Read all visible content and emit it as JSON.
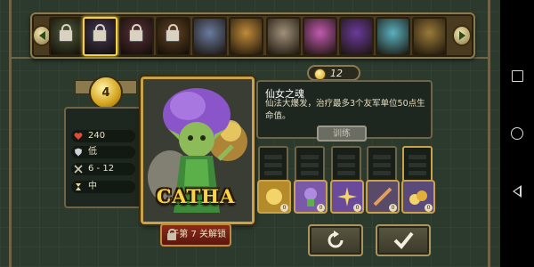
{
  "hero": {
    "name": "CATHA",
    "level": "4"
  },
  "stats": [
    {
      "icon": "heart-icon",
      "value": "240",
      "color": "#e04a3a"
    },
    {
      "icon": "shield-icon",
      "value": "低",
      "color": "#cfd4d6"
    },
    {
      "icon": "swords-icon",
      "value": "6 - 12",
      "color": "#cfcab6"
    },
    {
      "icon": "hourglass-icon",
      "value": "中",
      "color": "#e6d7a5"
    }
  ],
  "coins": {
    "value": "12"
  },
  "skill": {
    "title": "仙女之魂",
    "description": "仙法大爆发，治疗最多3个友军单位50点生命值。"
  },
  "train_button": "训练",
  "unlock_button": "于第 7 关解锁",
  "skill_levels": [
    "0",
    "0",
    "0",
    "0",
    "0"
  ],
  "portraits": [
    {
      "name": "hero-1",
      "locked": true,
      "color": "#7a8b5a"
    },
    {
      "name": "hero-2",
      "locked": true,
      "color": "#6b5a8a"
    },
    {
      "name": "hero-3",
      "locked": true,
      "color": "#8a4a5a"
    },
    {
      "name": "hero-4",
      "locked": true,
      "color": "#9a6a3a"
    },
    {
      "name": "hero-5",
      "locked": false,
      "color": "#6a7aa0"
    },
    {
      "name": "hero-6",
      "locked": false,
      "color": "#c08a3a"
    },
    {
      "name": "hero-7",
      "locked": false,
      "color": "#a0907a"
    },
    {
      "name": "hero-8",
      "locked": false,
      "color": "#c05ab0"
    },
    {
      "name": "hero-9",
      "locked": false,
      "color": "#6a3a9a"
    },
    {
      "name": "hero-10",
      "locked": false,
      "color": "#5ab0c0"
    },
    {
      "name": "hero-11",
      "locked": false,
      "color": "#9a7a3a"
    }
  ],
  "colors": {
    "accent_gold": "#f7d444",
    "frame": "#8b7a4f",
    "panel": "#1e271f",
    "unlock_red": "#8a2a1c"
  }
}
